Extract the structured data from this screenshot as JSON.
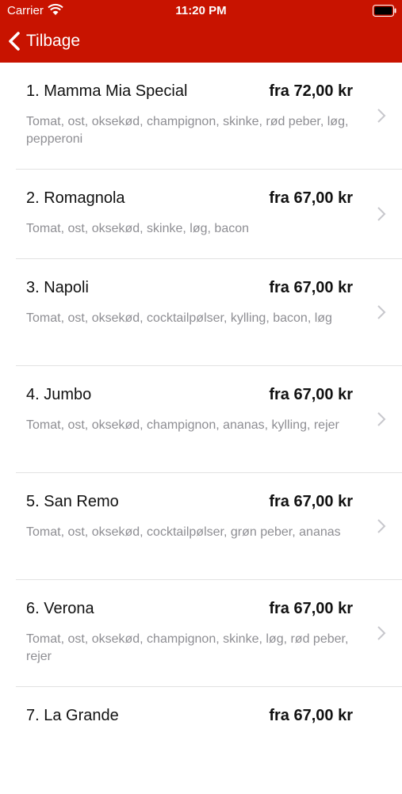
{
  "status_bar": {
    "carrier": "Carrier",
    "time": "11:20 PM"
  },
  "nav": {
    "back_label": "Tilbage"
  },
  "colors": {
    "header_bg": "#c81300",
    "secondary_text": "#8e8e93",
    "separator": "#e2e2e2"
  },
  "items": [
    {
      "name": "1. Mamma Mia Special",
      "price": "fra 72,00 kr",
      "ingredients": "Tomat, ost, oksekød, champignon, skinke, rød peber, løg, pepperoni"
    },
    {
      "name": "2. Romagnola",
      "price": "fra 67,00 kr",
      "ingredients": "Tomat, ost, oksekød, skinke, løg, bacon"
    },
    {
      "name": "3. Napoli",
      "price": "fra 67,00 kr",
      "ingredients": "Tomat, ost, oksekød, cocktailpølser, kylling, bacon, løg"
    },
    {
      "name": "4. Jumbo",
      "price": "fra 67,00 kr",
      "ingredients": "Tomat, ost, oksekød, champignon, ananas, kylling, rejer"
    },
    {
      "name": "5. San Remo",
      "price": "fra 67,00 kr",
      "ingredients": "Tomat, ost, oksekød, cocktailpølser, grøn peber, ananas"
    },
    {
      "name": "6. Verona",
      "price": "fra 67,00 kr",
      "ingredients": "Tomat, ost, oksekød, champignon, skinke, løg, rød peber, rejer"
    },
    {
      "name": "7. La Grande",
      "price": "fra 67,00 kr",
      "ingredients": ""
    }
  ]
}
